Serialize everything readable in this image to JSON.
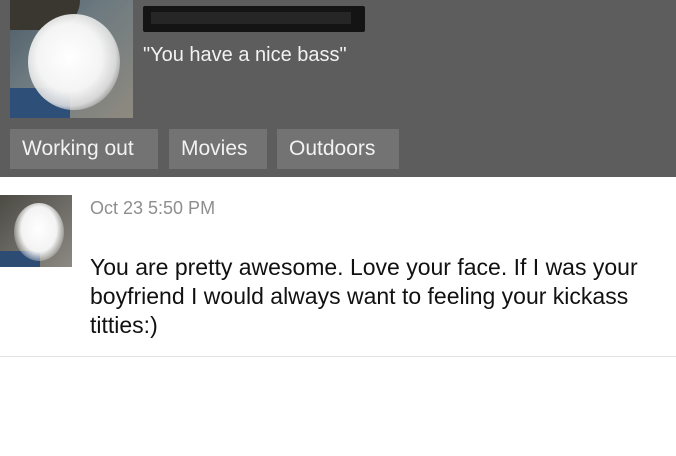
{
  "profile": {
    "quote": "\"You have a nice bass\"",
    "interests": [
      "Working out",
      "Movies",
      "Outdoors"
    ]
  },
  "message": {
    "timestamp": "Oct 23 5:50 PM",
    "text": "You are pretty awesome. Love your face. If I was your boyfriend I would always want to feeling your kickass titties:)"
  }
}
